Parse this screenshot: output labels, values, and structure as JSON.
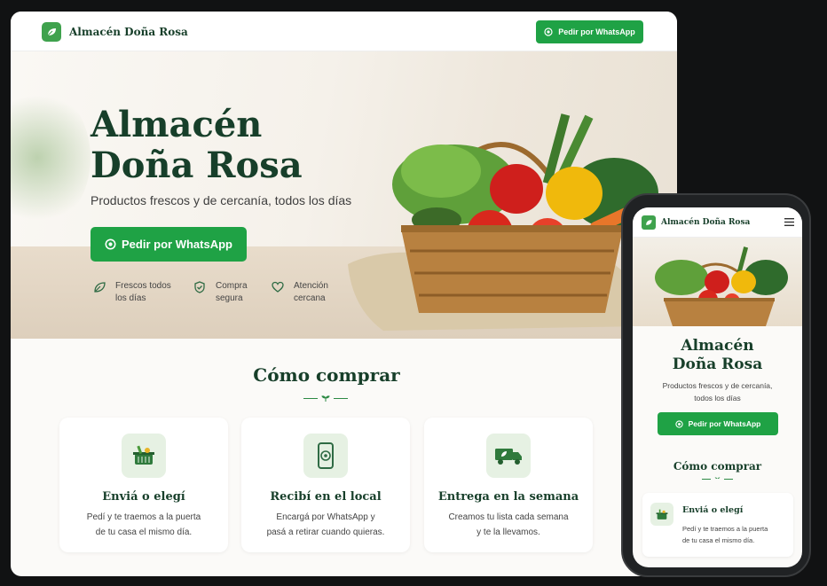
{
  "brand": {
    "name": "Almacén Doña Rosa",
    "color": "#173f2a",
    "accent": "#1fa245"
  },
  "header": {
    "cta": "Pedir por WhatsApp"
  },
  "hero": {
    "title_line1": "Almacén",
    "title_line2": "Doña Rosa",
    "subtitle": "Productos frescos y de cercanía, todos los días",
    "cta": "Pedir por WhatsApp",
    "features": [
      {
        "icon": "leaf-icon",
        "line1": "Frescos todos",
        "line2": "los días"
      },
      {
        "icon": "shield-icon",
        "line1": "Compra",
        "line2": "segura"
      },
      {
        "icon": "heart-icon",
        "line1": "Atención",
        "line2": "cercana"
      }
    ]
  },
  "how": {
    "title": "Cómo comprar",
    "cards": [
      {
        "icon": "basket-icon",
        "title": "Enviá o elegí",
        "line1": "Pedí y te traemos a la puerta",
        "line2": "de tu casa el mismo día."
      },
      {
        "icon": "phone-whatsapp-icon",
        "title": "Recibí en el local",
        "line1": "Encargá por WhatsApp y",
        "line2": "pasá a retirar cuando quieras."
      },
      {
        "icon": "delivery-truck-icon",
        "title": "Entrega en la semana",
        "line1": "Creamos tu lista cada semana",
        "line2": "y te la llevamos."
      }
    ]
  },
  "mobile": {
    "brand": "Almacén Doña Rosa",
    "title_line1": "Almacén",
    "title_line2": "Doña Rosa",
    "sub_line1": "Productos frescos y de cercanía,",
    "sub_line2": "todos los días",
    "cta": "Pedir por WhatsApp",
    "how_title": "Cómo comprar",
    "card": {
      "title": "Enviá o elegí",
      "line1": "Pedí y te traemos a la puerta",
      "line2": "de tu casa el mismo día."
    }
  }
}
